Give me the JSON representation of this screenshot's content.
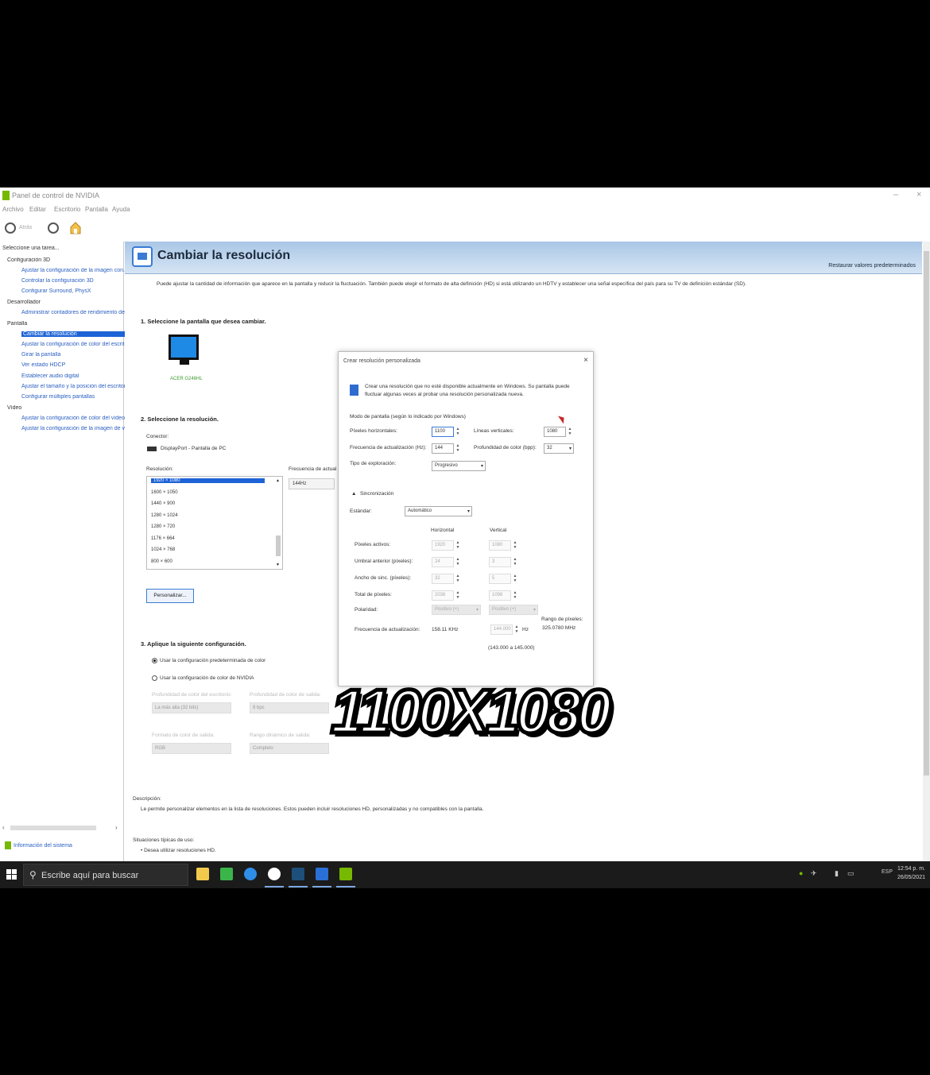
{
  "window": {
    "title": "Panel de control de NVIDIA",
    "minimize": "–",
    "close": "×",
    "menu": [
      "Archivo",
      "Editar",
      "Escritorio",
      "Pantalla",
      "Ayuda"
    ]
  },
  "toolbar": {
    "back_label": "Atrás"
  },
  "sidebar": {
    "header": "Seleccione una tarea...",
    "tree": [
      {
        "label": "Configuración 3D",
        "type": "cat"
      },
      {
        "label": "Ajustar la configuración de la imagen con...",
        "type": "leaf"
      },
      {
        "label": "Controlar la configuración 3D",
        "type": "leaf"
      },
      {
        "label": "Configurar Surround, PhysX",
        "type": "leaf"
      },
      {
        "label": "Desarrollador",
        "type": "cat"
      },
      {
        "label": "Administrar contadores de rendimiento de...",
        "type": "leaf"
      },
      {
        "label": "Pantalla",
        "type": "cat"
      },
      {
        "label": "Cambiar la resolución",
        "type": "sel"
      },
      {
        "label": "Ajustar la configuración de color del escrito...",
        "type": "leaf"
      },
      {
        "label": "Girar la pantalla",
        "type": "leaf"
      },
      {
        "label": "Ver estado HDCP",
        "type": "leaf"
      },
      {
        "label": "Establecer audio digital",
        "type": "leaf"
      },
      {
        "label": "Ajustar el tamaño y la posición del escritorio",
        "type": "leaf"
      },
      {
        "label": "Configurar múltiples pantallas",
        "type": "leaf"
      },
      {
        "label": "Vídeo",
        "type": "cat"
      },
      {
        "label": "Ajustar la configuración de color del vídeo",
        "type": "leaf"
      },
      {
        "label": "Ajustar la configuración de la imagen de vi...",
        "type": "leaf"
      }
    ],
    "scroll_left": "‹",
    "scroll_right": "›",
    "info_link": "Información del sistema"
  },
  "page": {
    "title": "Cambiar la resolución",
    "restore": "Restaurar valores predeterminados",
    "description": "Puede ajustar la cantidad de información que aparece en la pantalla y reducir la fluctuación. También puede elegir el formato de alta definición (HD) si está utilizando un HDTV y establecer una señal específica del país para su TV de definición estándar (SD).",
    "step1": "1. Seleccione la pantalla que desea cambiar.",
    "monitor_label": "ACER G246HL",
    "step2": "2. Seleccione la resolución.",
    "connector_label": "Conector:",
    "connector_value": "DisplayPort - Pantalla de PC",
    "resolution_label": "Resolución:",
    "resolutions": [
      "1920 × 1080",
      "1600 × 1050",
      "1440 × 900",
      "1280 × 1024",
      "1280 × 720",
      "1176 × 664",
      "1024 × 768",
      "800 × 600"
    ],
    "refresh_label": "Frecuencia de actualización:",
    "refresh_value": "144Hz",
    "customize_button": "Personalizar...",
    "step3": "3. Aplique la siguiente configuración.",
    "radio_default": "Usar la configuración predeterminada de color",
    "radio_nvidia": "Usar la configuración de color de NVIDIA",
    "disabled_label_1": "Profundidad de color del escritorio:",
    "disabled_label_2": "Profundidad de color de salida:",
    "disabled_select_1": "La más alta (32 bits)",
    "disabled_select_2": "8 bpc",
    "disabled_label_3": "Formato de color de salida:",
    "disabled_label_4": "Rango dinámico de salida:",
    "disabled_select_3": "RGB",
    "disabled_select_4": "Completo",
    "desc_heading": "Descripción:",
    "desc_text": "Le permite personalizar elementos en la lista de resoluciones. Estos pueden incluir resoluciones HD, personalizadas y no compatibles con la pantalla.",
    "usage_heading": "Situaciones típicas de uso:",
    "usage_item": "• Desea utilizar resoluciones HD."
  },
  "dialog": {
    "title": "Crear resolución personalizada",
    "close": "×",
    "info_line1": "Crear una resolución que no esté disponible actualmente en Windows. Su pantalla puede",
    "info_line2": "fluctuar algunas veces al probar una resolución personalizada nueva.",
    "mode_heading": "Modo de pantalla (según lo indicado por Windows)",
    "h_pixels_label": "Píxeles horizontales:",
    "h_pixels_value": "1100",
    "v_lines_label": "Líneas verticales:",
    "v_lines_value": "1080",
    "refresh_label": "Frecuencia de actualización (Hz):",
    "refresh_value": "144",
    "color_depth_label": "Profundidad de color (bpp):",
    "color_depth_value": "32",
    "scan_label": "Tipo de exploración:",
    "scan_value": "Progresivo",
    "sync_heading": "Sincronización",
    "standard_label": "Estándar:",
    "standard_value": "Automático",
    "col_horizontal": "Horizontal",
    "col_vertical": "Vertical",
    "rows": [
      {
        "label": "Píxeles activos:",
        "h": "1920",
        "v": "1080"
      },
      {
        "label": "Umbral anterior (píxeles):",
        "h": "24",
        "v": "3"
      },
      {
        "label": "Ancho de sinc. (píxeles):",
        "h": "32",
        "v": "5"
      },
      {
        "label": "Total de píxeles:",
        "h": "2036",
        "v": "1098"
      }
    ],
    "polarity_label": "Polaridad:",
    "polarity_h": "Positivo (+)",
    "polarity_v": "Positivo (+)",
    "pixel_rate_label": "Rango de píxeles:",
    "pixel_rate_value": "325.0780 MHz",
    "refresh_rate_label": "Frecuencia de actualización:",
    "refresh_h_value": "158.11 KHz",
    "refresh_v_value": "144.000",
    "refresh_unit": "Hz",
    "refresh_range": "(143.000 a 145.000)",
    "up_arrow": "▲",
    "down_arrow": "▼",
    "dropdown_arrow": "▾"
  },
  "overlay_text": "1100X1080",
  "taskbar": {
    "search_placeholder": "Escribe aquí para buscar",
    "search_glyph": "⚲",
    "tray_lang": "ESP",
    "time": "12:54 p. m.",
    "date": "26/05/2021"
  }
}
